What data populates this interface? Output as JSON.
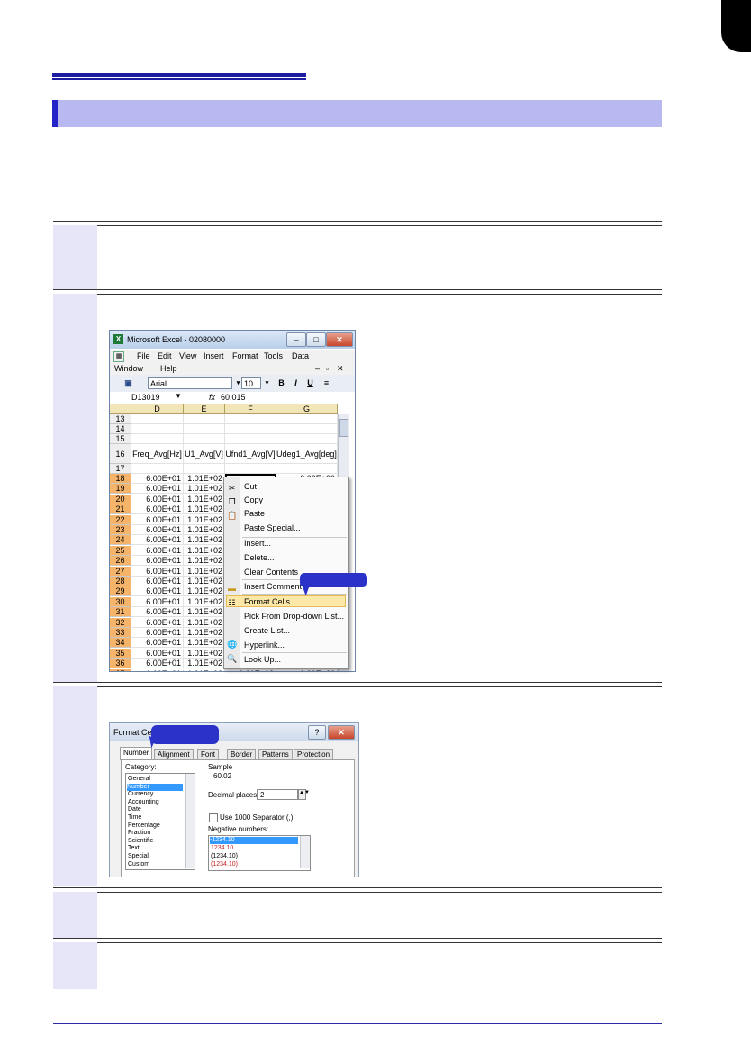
{
  "excel": {
    "title": "Microsoft Excel - 02080000",
    "menu_row1": [
      "File",
      "Edit",
      "View",
      "Insert",
      "Format",
      "Tools",
      "Data"
    ],
    "menu_row2": [
      "Window",
      "Help"
    ],
    "font_name": "Arial",
    "font_size": "10",
    "bold": "B",
    "italic": "I",
    "underline": "U",
    "name_box": "D13019",
    "fx": "fx",
    "formula_value": "60.015",
    "columns": [
      "D",
      "E",
      "F",
      "G"
    ],
    "top_rows": [
      "13",
      "14",
      "15",
      "16",
      "17"
    ],
    "headers": [
      "Freq_Avg[Hz]",
      "U1_Avg[V]",
      "Ufnd1_Avg[V]",
      "Udeg1_Avg[deg]"
    ],
    "data_rows": [
      "18",
      "19",
      "20",
      "21",
      "22",
      "23",
      "24",
      "25",
      "26",
      "27",
      "28",
      "29",
      "30",
      "31",
      "32",
      "33",
      "34",
      "35",
      "36",
      "37"
    ],
    "col_d_value": "6.00E+01",
    "col_e_value": "1.01E+02",
    "row18_f": "1.01E+02",
    "row18_g": "0.00E+00",
    "row37_f": "1.01E+02",
    "row37_g": "0.00E+00",
    "win_min": "–",
    "win_max": "□",
    "win_close": "✕"
  },
  "context_menu": {
    "items": [
      "Cut",
      "Copy",
      "Paste",
      "Paste Special...",
      "Insert...",
      "Delete...",
      "Clear Contents",
      "Insert Comment",
      "Format Cells...",
      "Pick From Drop-down List...",
      "Create List...",
      "Hyperlink...",
      "Look Up..."
    ],
    "icons": [
      "scissors-icon",
      "copy-icon",
      "paste-icon",
      "comment-icon",
      "format-cells-icon",
      "hyperlink-icon",
      "lookup-icon"
    ]
  },
  "format_cells": {
    "title": "Format Cell",
    "tabs": [
      "Number",
      "Alignment",
      "Font",
      "Border",
      "Patterns",
      "Protection"
    ],
    "category_label": "Category:",
    "categories": [
      "General",
      "Number",
      "Currency",
      "Accounting",
      "Date",
      "Time",
      "Percentage",
      "Fraction",
      "Scientific",
      "Text",
      "Special",
      "Custom"
    ],
    "sample_label": "Sample",
    "sample_value": "60.02",
    "decimal_label": "Decimal places:",
    "decimal_value": "2",
    "separator_label": "Use 1000 Separator (,)",
    "negative_label": "Negative numbers:",
    "negative_options": [
      "-1234.10",
      "1234.10",
      "(1234.10)",
      "(1234.10)"
    ],
    "help_btn": "?",
    "close_btn": "✕"
  },
  "colors": {
    "section_bar": "#b9b9f2",
    "step_column": "#e6e6f8",
    "callout": "#2a32c8",
    "heading_rule": "#1c1ca0"
  }
}
